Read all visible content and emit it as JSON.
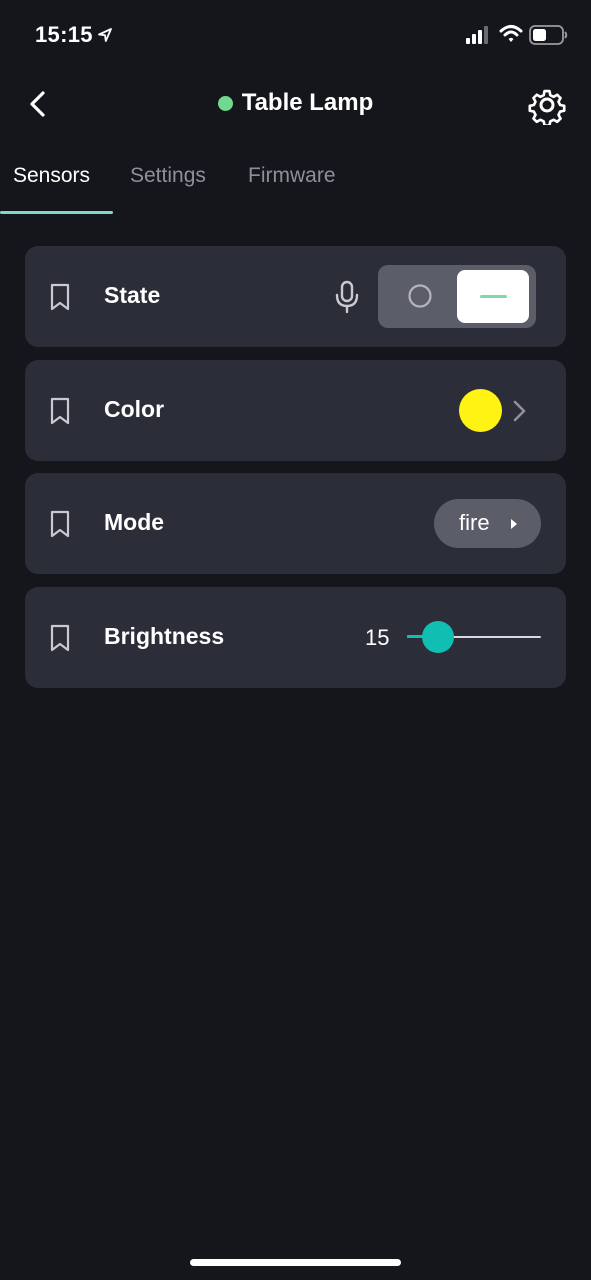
{
  "status_bar": {
    "time": "15:15",
    "icons": [
      "location-arrow-icon",
      "cellular-signal-icon",
      "wifi-icon",
      "battery-icon"
    ]
  },
  "header": {
    "title": "Table Lamp",
    "online_color": "#6fda8d",
    "back_icon": "chevron-left-icon",
    "settings_icon": "gear-icon"
  },
  "tabs": [
    {
      "label": "Sensors",
      "active": true
    },
    {
      "label": "Settings",
      "active": false
    },
    {
      "label": "Firmware",
      "active": false
    }
  ],
  "sensors": {
    "state": {
      "label": "State",
      "value": "on",
      "icon": "microphone-icon"
    },
    "color": {
      "label": "Color",
      "value_color": "#fff314"
    },
    "mode": {
      "label": "Mode",
      "value": "fire"
    },
    "brightness": {
      "label": "Brightness",
      "value": "15",
      "fraction": 0.15
    }
  },
  "colors": {
    "background": "#15161b",
    "card": "#2b2d38",
    "accent": "#11bfb2",
    "tab_underline": "#7fd9c6"
  }
}
